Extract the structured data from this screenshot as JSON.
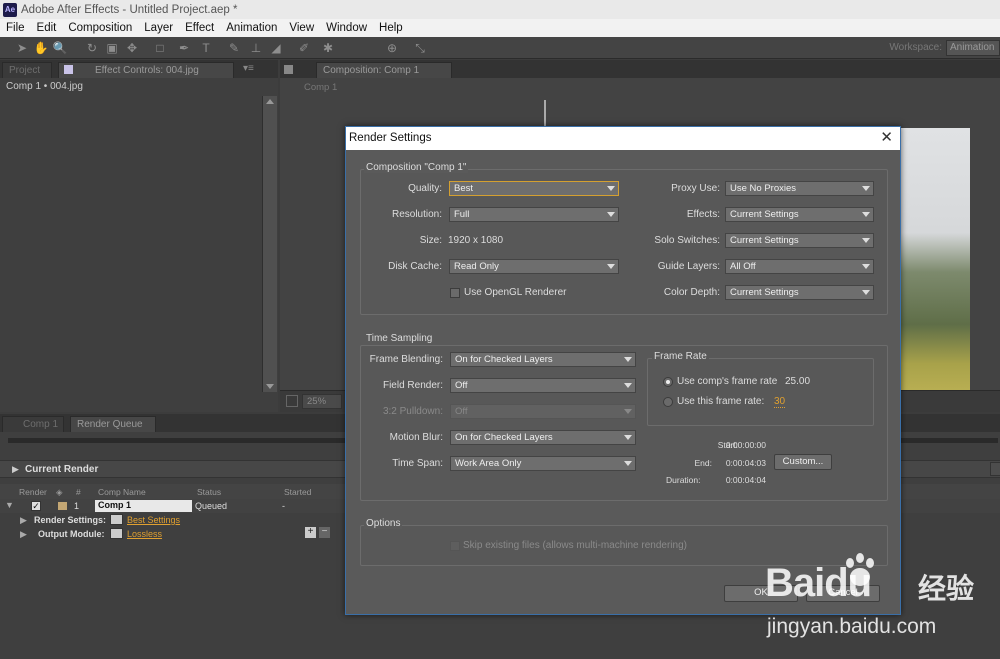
{
  "app": {
    "title": "Adobe After Effects - Untitled Project.aep *",
    "icon_text": "Ae"
  },
  "menu": [
    "File",
    "Edit",
    "Composition",
    "Layer",
    "Effect",
    "Animation",
    "View",
    "Window",
    "Help"
  ],
  "toolbar": {
    "workspace_label": "Workspace:",
    "workspace_value": "Animation"
  },
  "left_panel": {
    "tab_project": "Project",
    "tab_effect_controls": "Effect Controls: 004.jpg",
    "breadcrumb": "Comp 1 • 004.jpg"
  },
  "comp_panel": {
    "tab": "Composition: Comp 1",
    "breadcrumb": "Comp 1",
    "zoom": "25%"
  },
  "bottom": {
    "tab_comp": "Comp 1",
    "tab_rq": "Render Queue",
    "current_render": "Current Render",
    "headers": {
      "render": "Render",
      "num": "#",
      "comp_name": "Comp Name",
      "status": "Status",
      "started": "Started"
    },
    "row": {
      "num": "1",
      "comp": "Comp 1",
      "status": "Queued",
      "started": "-"
    },
    "render_settings_label": "Render Settings:",
    "render_settings_value": "Best Settings",
    "output_module_label": "Output Module:",
    "output_module_value": "Lossless"
  },
  "dialog": {
    "title": "Render Settings",
    "composition": {
      "group_title": "Composition \"Comp 1\"",
      "quality_label": "Quality:",
      "quality": "Best",
      "resolution_label": "Resolution:",
      "resolution": "Full",
      "size_label": "Size:",
      "size": "1920 x 1080",
      "disk_cache_label": "Disk Cache:",
      "disk_cache": "Read Only",
      "opengl_label": "Use OpenGL Renderer",
      "proxy_label": "Proxy Use:",
      "proxy": "Use No Proxies",
      "effects_label": "Effects:",
      "effects": "Current Settings",
      "solo_label": "Solo Switches:",
      "solo": "Current Settings",
      "guide_label": "Guide Layers:",
      "guide": "All Off",
      "color_label": "Color Depth:",
      "color": "Current Settings"
    },
    "time": {
      "group_title": "Time Sampling",
      "blending_label": "Frame Blending:",
      "blending": "On for Checked Layers",
      "field_label": "Field Render:",
      "field": "Off",
      "pulldown_label": "3:2 Pulldown:",
      "pulldown": "Off",
      "motion_label": "Motion Blur:",
      "motion": "On for Checked Layers",
      "span_label": "Time Span:",
      "span": "Work Area Only",
      "frame_rate_title": "Frame Rate",
      "use_comp_label": "Use comp's frame rate",
      "use_comp_value": "25.00",
      "use_this_label": "Use this frame rate:",
      "use_this_value": "30",
      "start_label": "Start:",
      "start": "0:00:00:00",
      "end_label": "End:",
      "end": "0:00:04:03",
      "duration_label": "Duration:",
      "duration": "0:00:04:04",
      "custom_button": "Custom..."
    },
    "options": {
      "group_title": "Options",
      "skip_label": "Skip existing files (allows multi-machine rendering)"
    },
    "ok_button": "OK",
    "cancel_button": "Cancel"
  },
  "watermark": {
    "brand": "Baidu",
    "cn": "经验",
    "url": "jingyan.baidu.com"
  }
}
